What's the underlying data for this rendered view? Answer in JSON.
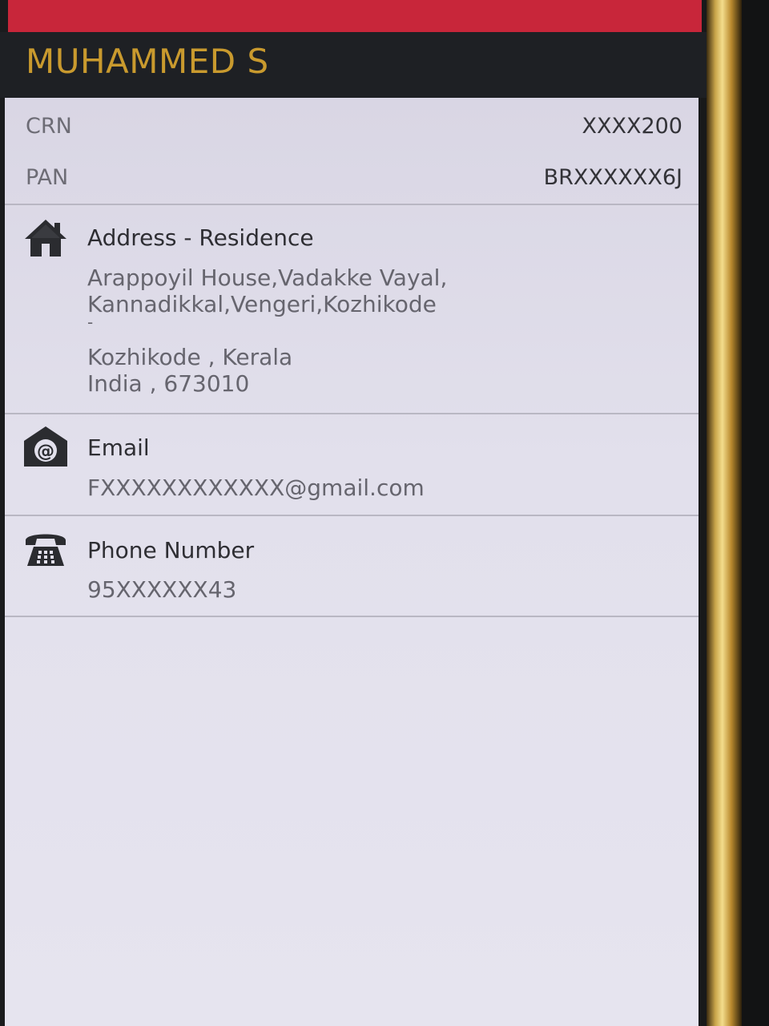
{
  "profile": {
    "name": "MUHAMMED S"
  },
  "identifiers": [
    {
      "label": "CRN",
      "value": "XXXX200"
    },
    {
      "label": "PAN",
      "value": "BRXXXXXX6J"
    }
  ],
  "address": {
    "icon": "home-icon",
    "title": "Address - Residence",
    "lines": [
      "Arappoyil House,Vadakke Vayal,",
      " Kannadikkal,Vengeri,Kozhikode",
      " -",
      " Kozhikode , Kerala",
      " India , 673010"
    ]
  },
  "email": {
    "icon": "email-at-icon",
    "title": "Email",
    "value": "FXXXXXXXXXXXX@gmail.com"
  },
  "phone": {
    "icon": "telephone-icon",
    "title": "Phone Number",
    "value": "95XXXXXX43"
  },
  "colors": {
    "top_bar": "#c8263a",
    "name_text": "#c99a2e",
    "header_bg": "#1e2024",
    "content_bg": "#e2e0ec"
  }
}
